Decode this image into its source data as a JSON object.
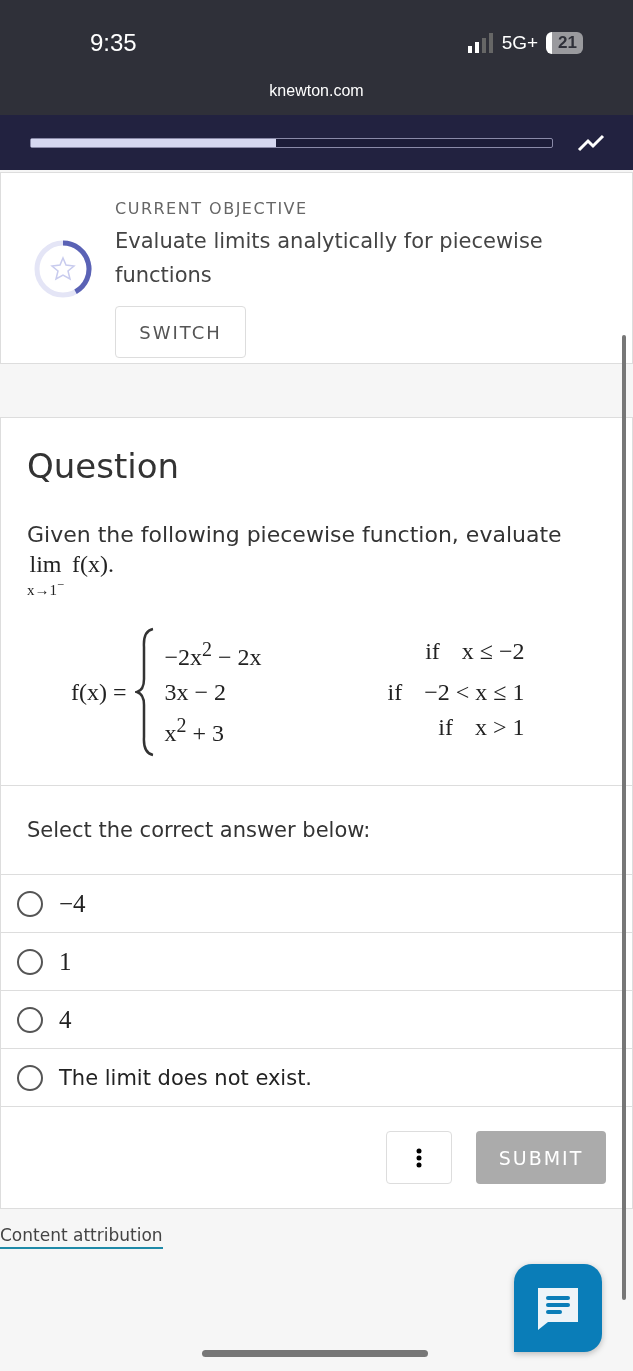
{
  "status_bar": {
    "time": "9:35",
    "network": "5G+",
    "battery": "21"
  },
  "browser": {
    "url": "knewton.com"
  },
  "mastery": {
    "level": 0.47
  },
  "objective": {
    "label": "CURRENT OBJECTIVE",
    "title": "Evaluate limits analytically for piecewise functions",
    "level": 0.42,
    "button": "SWITCH"
  },
  "question": {
    "heading": "Question",
    "prompt": "Given the following piecewise function, evaluate",
    "limit": {
      "operator": "lim",
      "subscript": "x→1$^{−}$",
      "expression": "f(x)."
    },
    "function_lhs": "f(x) =",
    "cases": [
      {
        "expression": "−2x$^{2}$ − 2x",
        "keyword": "if",
        "condition": "x ≤ −2"
      },
      {
        "expression": "3x − 2",
        "keyword": "if",
        "condition": "−2 < x ≤ 1"
      },
      {
        "expression": "x$^{2}$ + 3",
        "keyword": "if",
        "condition": "x > 1"
      }
    ]
  },
  "instruction": "Select the correct answer below:",
  "choices": [
    {
      "label": "−4",
      "kind": "math",
      "selected": false
    },
    {
      "label": "1",
      "kind": "math",
      "selected": false
    },
    {
      "label": "4",
      "kind": "math",
      "selected": false
    },
    {
      "label": "The limit does not exist.",
      "kind": "text",
      "selected": false
    }
  ],
  "submit": {
    "label": "SUBMIT",
    "disabled": true
  },
  "footer_link": "Content attribution"
}
